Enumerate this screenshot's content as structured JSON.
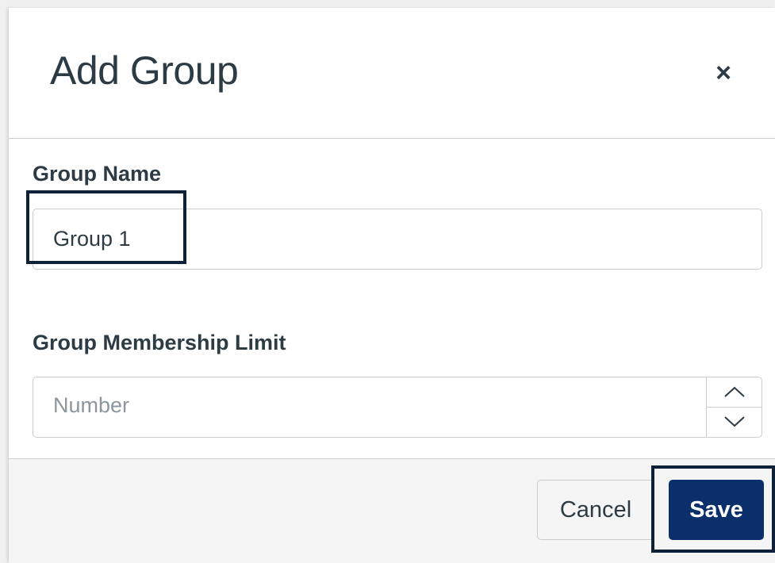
{
  "dialog": {
    "title": "Add Group",
    "close_glyph": "×",
    "close_icon": "close-icon"
  },
  "fields": {
    "group_name": {
      "label": "Group Name",
      "value": "Group 1"
    },
    "membership_limit": {
      "label": "Group Membership Limit",
      "placeholder": "Number",
      "stepper_icons": [
        "chevron-up-icon",
        "chevron-down-icon"
      ]
    }
  },
  "footer": {
    "cancel_label": "Cancel",
    "save_label": "Save"
  },
  "colors": {
    "text": "#2d3b45",
    "save_button": "#0b2f6b",
    "highlight_box": "#0d2238",
    "border": "#c7cdd1"
  }
}
